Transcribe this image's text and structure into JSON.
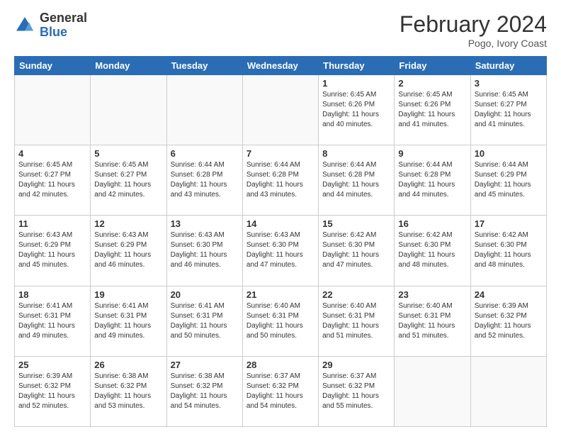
{
  "logo": {
    "general": "General",
    "blue": "Blue"
  },
  "header": {
    "month": "February 2024",
    "location": "Pogo, Ivory Coast"
  },
  "weekdays": [
    "Sunday",
    "Monday",
    "Tuesday",
    "Wednesday",
    "Thursday",
    "Friday",
    "Saturday"
  ],
  "weeks": [
    [
      {
        "day": "",
        "info": ""
      },
      {
        "day": "",
        "info": ""
      },
      {
        "day": "",
        "info": ""
      },
      {
        "day": "",
        "info": ""
      },
      {
        "day": "1",
        "info": "Sunrise: 6:45 AM\nSunset: 6:26 PM\nDaylight: 11 hours\nand 40 minutes."
      },
      {
        "day": "2",
        "info": "Sunrise: 6:45 AM\nSunset: 6:26 PM\nDaylight: 11 hours\nand 41 minutes."
      },
      {
        "day": "3",
        "info": "Sunrise: 6:45 AM\nSunset: 6:27 PM\nDaylight: 11 hours\nand 41 minutes."
      }
    ],
    [
      {
        "day": "4",
        "info": "Sunrise: 6:45 AM\nSunset: 6:27 PM\nDaylight: 11 hours\nand 42 minutes."
      },
      {
        "day": "5",
        "info": "Sunrise: 6:45 AM\nSunset: 6:27 PM\nDaylight: 11 hours\nand 42 minutes."
      },
      {
        "day": "6",
        "info": "Sunrise: 6:44 AM\nSunset: 6:28 PM\nDaylight: 11 hours\nand 43 minutes."
      },
      {
        "day": "7",
        "info": "Sunrise: 6:44 AM\nSunset: 6:28 PM\nDaylight: 11 hours\nand 43 minutes."
      },
      {
        "day": "8",
        "info": "Sunrise: 6:44 AM\nSunset: 6:28 PM\nDaylight: 11 hours\nand 44 minutes."
      },
      {
        "day": "9",
        "info": "Sunrise: 6:44 AM\nSunset: 6:28 PM\nDaylight: 11 hours\nand 44 minutes."
      },
      {
        "day": "10",
        "info": "Sunrise: 6:44 AM\nSunset: 6:29 PM\nDaylight: 11 hours\nand 45 minutes."
      }
    ],
    [
      {
        "day": "11",
        "info": "Sunrise: 6:43 AM\nSunset: 6:29 PM\nDaylight: 11 hours\nand 45 minutes."
      },
      {
        "day": "12",
        "info": "Sunrise: 6:43 AM\nSunset: 6:29 PM\nDaylight: 11 hours\nand 46 minutes."
      },
      {
        "day": "13",
        "info": "Sunrise: 6:43 AM\nSunset: 6:30 PM\nDaylight: 11 hours\nand 46 minutes."
      },
      {
        "day": "14",
        "info": "Sunrise: 6:43 AM\nSunset: 6:30 PM\nDaylight: 11 hours\nand 47 minutes."
      },
      {
        "day": "15",
        "info": "Sunrise: 6:42 AM\nSunset: 6:30 PM\nDaylight: 11 hours\nand 47 minutes."
      },
      {
        "day": "16",
        "info": "Sunrise: 6:42 AM\nSunset: 6:30 PM\nDaylight: 11 hours\nand 48 minutes."
      },
      {
        "day": "17",
        "info": "Sunrise: 6:42 AM\nSunset: 6:30 PM\nDaylight: 11 hours\nand 48 minutes."
      }
    ],
    [
      {
        "day": "18",
        "info": "Sunrise: 6:41 AM\nSunset: 6:31 PM\nDaylight: 11 hours\nand 49 minutes."
      },
      {
        "day": "19",
        "info": "Sunrise: 6:41 AM\nSunset: 6:31 PM\nDaylight: 11 hours\nand 49 minutes."
      },
      {
        "day": "20",
        "info": "Sunrise: 6:41 AM\nSunset: 6:31 PM\nDaylight: 11 hours\nand 50 minutes."
      },
      {
        "day": "21",
        "info": "Sunrise: 6:40 AM\nSunset: 6:31 PM\nDaylight: 11 hours\nand 50 minutes."
      },
      {
        "day": "22",
        "info": "Sunrise: 6:40 AM\nSunset: 6:31 PM\nDaylight: 11 hours\nand 51 minutes."
      },
      {
        "day": "23",
        "info": "Sunrise: 6:40 AM\nSunset: 6:31 PM\nDaylight: 11 hours\nand 51 minutes."
      },
      {
        "day": "24",
        "info": "Sunrise: 6:39 AM\nSunset: 6:32 PM\nDaylight: 11 hours\nand 52 minutes."
      }
    ],
    [
      {
        "day": "25",
        "info": "Sunrise: 6:39 AM\nSunset: 6:32 PM\nDaylight: 11 hours\nand 52 minutes."
      },
      {
        "day": "26",
        "info": "Sunrise: 6:38 AM\nSunset: 6:32 PM\nDaylight: 11 hours\nand 53 minutes."
      },
      {
        "day": "27",
        "info": "Sunrise: 6:38 AM\nSunset: 6:32 PM\nDaylight: 11 hours\nand 54 minutes."
      },
      {
        "day": "28",
        "info": "Sunrise: 6:37 AM\nSunset: 6:32 PM\nDaylight: 11 hours\nand 54 minutes."
      },
      {
        "day": "29",
        "info": "Sunrise: 6:37 AM\nSunset: 6:32 PM\nDaylight: 11 hours\nand 55 minutes."
      },
      {
        "day": "",
        "info": ""
      },
      {
        "day": "",
        "info": ""
      }
    ]
  ]
}
